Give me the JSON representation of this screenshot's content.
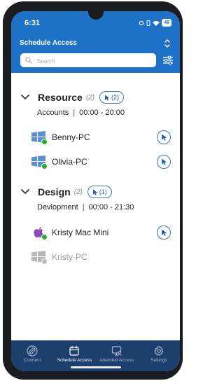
{
  "status_bar": {
    "time": "6:31",
    "battery": "48"
  },
  "header": {
    "title": "Schedule Access",
    "search_placeholder": "Search"
  },
  "groups": [
    {
      "name": "Resource",
      "count": "(2)",
      "sessions": "(2)",
      "department": "Accounts",
      "hours": "00:00 - 20:00",
      "devices": [
        {
          "name": "Benny-PC",
          "os": "windows",
          "online": true
        },
        {
          "name": "Olivia-PC",
          "os": "windows",
          "online": true
        }
      ]
    },
    {
      "name": "Design",
      "count": "(2)",
      "sessions": "(1)",
      "department": "Devlopment",
      "hours": "00:00 - 21:30",
      "devices": [
        {
          "name": "Kristy Mac Mini",
          "os": "apple",
          "online": true
        },
        {
          "name": "Kristy-PC",
          "os": "windows",
          "online": false
        }
      ]
    }
  ],
  "tabs": [
    {
      "label": "Connect",
      "icon": "link-icon"
    },
    {
      "label": "Schedule Access",
      "icon": "calendar-icon",
      "active": true
    },
    {
      "label": "Attended Access",
      "icon": "monitor-user-icon"
    },
    {
      "label": "Settings",
      "icon": "gear-icon"
    }
  ],
  "colors": {
    "brand": "#1d71c6",
    "tabbar": "#1c3f6e",
    "online": "#27b22a",
    "accent": "#3377c4"
  }
}
